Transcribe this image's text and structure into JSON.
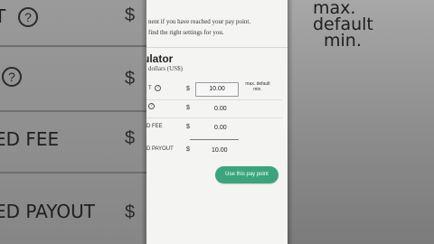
{
  "zoom_left": {
    "rows": [
      {
        "label": "T",
        "help": "?",
        "currency": "$"
      },
      {
        "label": "",
        "help": "?",
        "currency": "$"
      },
      {
        "label": "ED FEE",
        "help": "",
        "currency": "$"
      },
      {
        "label": "ED PAYOUT",
        "help": "",
        "currency": "$"
      }
    ]
  },
  "zoom_right": {
    "lines": [
      "max.",
      "default",
      "min."
    ]
  },
  "intro": {
    "line1": "nent if you have reached your pay point.",
    "line2": "find the right settings for you."
  },
  "calculator": {
    "title": "ulator",
    "subtitle": "dollars (US$)",
    "rows": [
      {
        "label": "T",
        "help": "?",
        "currency": "$",
        "value": "10.00",
        "note": "max. default min."
      },
      {
        "label": "",
        "help": "?",
        "currency": "$",
        "value": "0.00"
      },
      {
        "label": "D FEE",
        "help": "",
        "currency": "$",
        "value": "0.00"
      },
      {
        "label": "D PAYOUT",
        "help": "",
        "currency": "$",
        "value": "10.00"
      }
    ],
    "cta_label": "Use this pay point"
  },
  "colors": {
    "accent": "#3aa57c",
    "screen_bg": "#f4f4f2"
  }
}
